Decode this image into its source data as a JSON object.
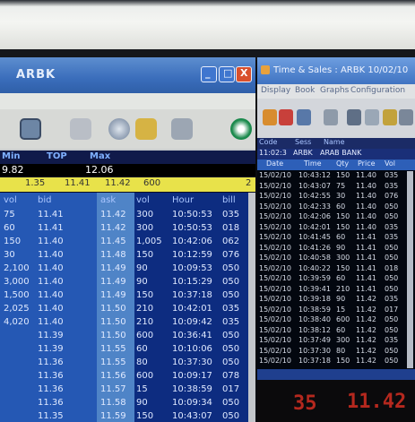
{
  "left_window": {
    "title": "ARBK",
    "controls": {
      "min": "_",
      "max": "□",
      "close": "X"
    },
    "toolbar_icons": [
      "screen-icon",
      "document-icon",
      "globe-icon",
      "key-icon",
      "printer-icon",
      "globe-logo-icon"
    ],
    "header_labels": {
      "c1": "Min",
      "c2": "TOP",
      "c3": "Max"
    },
    "header_values": {
      "c1": "9.82",
      "c3": "12.06"
    },
    "yellow_row": {
      "c1": "1.35",
      "c2": "11.41",
      "c3": "11.42",
      "c4": "600",
      "end": "2"
    },
    "columns": [
      "vol",
      "bid",
      "ask",
      "vol",
      "Hour",
      "bill"
    ],
    "rows": [
      [
        "75",
        "11.41",
        "11.42",
        "300",
        "10:50:53",
        "035"
      ],
      [
        "60",
        "11.41",
        "11.42",
        "300",
        "10:50:53",
        "018"
      ],
      [
        "150",
        "11.40",
        "11.45",
        "1,005",
        "10:42:06",
        "062"
      ],
      [
        "30",
        "11.40",
        "11.48",
        "150",
        "10:12:59",
        "076"
      ],
      [
        "2,100",
        "11.40",
        "11.49",
        "90",
        "10:09:53",
        "050"
      ],
      [
        "3,000",
        "11.40",
        "11.49",
        "90",
        "10:15:29",
        "050"
      ],
      [
        "1,500",
        "11.40",
        "11.49",
        "150",
        "10:37:18",
        "050"
      ],
      [
        "2,025",
        "11.40",
        "11.50",
        "210",
        "10:42:01",
        "035"
      ],
      [
        "4,020",
        "11.40",
        "11.50",
        "210",
        "10:09:42",
        "035"
      ],
      [
        "",
        "11.39",
        "11.50",
        "600",
        "10:36:41",
        "050"
      ],
      [
        "",
        "11.39",
        "11.55",
        "60",
        "10:10:06",
        "050"
      ],
      [
        "",
        "11.36",
        "11.55",
        "80",
        "10:37:30",
        "050"
      ],
      [
        "",
        "11.36",
        "11.56",
        "600",
        "10:09:17",
        "078"
      ],
      [
        "",
        "11.36",
        "11.57",
        "15",
        "10:38:59",
        "017"
      ],
      [
        "",
        "11.36",
        "11.58",
        "90",
        "10:09:34",
        "050"
      ],
      [
        "",
        "11.35",
        "11.59",
        "150",
        "10:43:07",
        "050"
      ]
    ]
  },
  "right_window": {
    "title": "Time & Sales : ARBK 10/02/10",
    "menu": [
      "Display",
      "Book",
      "Graphs",
      "Configuration"
    ],
    "header": [
      "Code",
      "Sess",
      "Name"
    ],
    "info": [
      "11:02:3",
      "ARBK",
      "ARAB BANK"
    ],
    "columns": [
      "Date",
      "Time",
      "Qty",
      "Price",
      "Vol"
    ],
    "rows": [
      [
        "15/02/10",
        "10:43:12",
        "150",
        "11.40",
        "035"
      ],
      [
        "15/02/10",
        "10:43:07",
        "75",
        "11.40",
        "035"
      ],
      [
        "15/02/10",
        "10:42:55",
        "30",
        "11.40",
        "076"
      ],
      [
        "15/02/10",
        "10:42:33",
        "60",
        "11.40",
        "050"
      ],
      [
        "15/02/10",
        "10:42:06",
        "150",
        "11.40",
        "050"
      ],
      [
        "15/02/10",
        "10:42:01",
        "150",
        "11.40",
        "035"
      ],
      [
        "15/02/10",
        "10:41:45",
        "60",
        "11.41",
        "035"
      ],
      [
        "15/02/10",
        "10:41:26",
        "90",
        "11.41",
        "050"
      ],
      [
        "15/02/10",
        "10:40:58",
        "300",
        "11.41",
        "050"
      ],
      [
        "15/02/10",
        "10:40:22",
        "150",
        "11.41",
        "018"
      ],
      [
        "15/02/10",
        "10:39:59",
        "60",
        "11.41",
        "050"
      ],
      [
        "15/02/10",
        "10:39:41",
        "210",
        "11.41",
        "050"
      ],
      [
        "15/02/10",
        "10:39:18",
        "90",
        "11.42",
        "035"
      ],
      [
        "15/02/10",
        "10:38:59",
        "15",
        "11.42",
        "017"
      ],
      [
        "15/02/10",
        "10:38:40",
        "600",
        "11.42",
        "050"
      ],
      [
        "15/02/10",
        "10:38:12",
        "60",
        "11.42",
        "050"
      ],
      [
        "15/02/10",
        "10:37:49",
        "300",
        "11.42",
        "035"
      ],
      [
        "15/02/10",
        "10:37:30",
        "80",
        "11.42",
        "050"
      ],
      [
        "15/02/10",
        "10:37:18",
        "150",
        "11.42",
        "050"
      ]
    ]
  },
  "ticker": {
    "left": "35",
    "right": "11.42"
  },
  "colors": {
    "panel_dark": "#0a0e24",
    "bid_col": "#2558b4",
    "yellow": "#e8e24a",
    "ticker_red": "#b5281e"
  }
}
